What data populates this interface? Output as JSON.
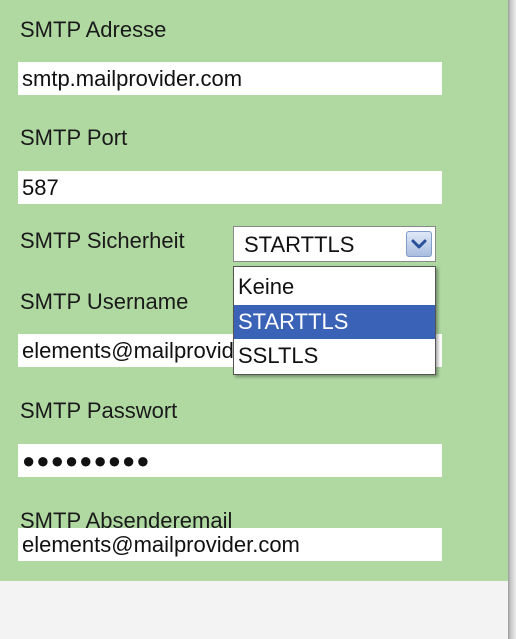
{
  "form": {
    "smtp_address_label": "SMTP Adresse",
    "smtp_address_value": "smtp.mailprovider.com",
    "smtp_port_label": "SMTP Port",
    "smtp_port_value": "587",
    "smtp_security_label": "SMTP Sicherheit",
    "smtp_security_selected": "STARTTLS",
    "smtp_security_options": [
      "Keine",
      "STARTTLS",
      "SSLTLS"
    ],
    "smtp_username_label": "SMTP Username",
    "smtp_username_value": "elements@mailprovider.com",
    "smtp_password_label": "SMTP Passwort",
    "smtp_password_value": "●●●●●●●●●",
    "smtp_sender_label": "SMTP Absenderemail",
    "smtp_sender_value": "elements@mailprovider.com"
  },
  "colors": {
    "panel_bg": "#b0d9a2",
    "selection": "#3a63b8"
  },
  "icons": {
    "dropdown_arrow": "chevron-down-icon"
  }
}
